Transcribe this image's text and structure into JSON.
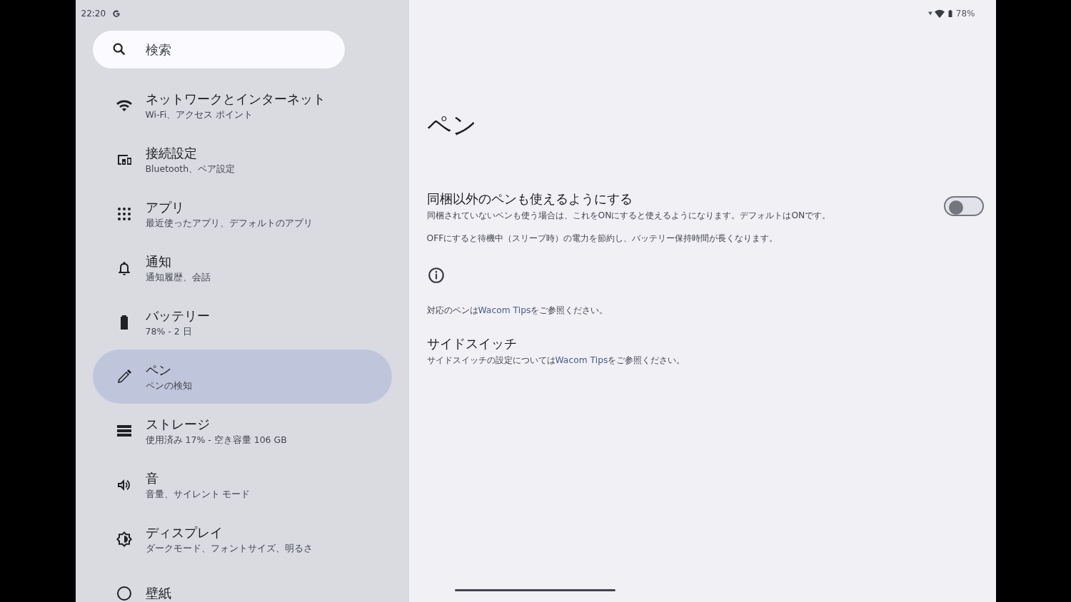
{
  "status_bar": {
    "time": "22:20",
    "battery": "78%"
  },
  "search": {
    "placeholder": "検索"
  },
  "sidebar": {
    "items": [
      {
        "kind": "wifi",
        "title": "ネットワークとインターネット",
        "subtitle": "Wi-Fi、アクセス ポイント",
        "selected": false
      },
      {
        "kind": "devices",
        "title": "接続設定",
        "subtitle": "Bluetooth、ペア設定",
        "selected": false
      },
      {
        "kind": "apps",
        "title": "アプリ",
        "subtitle": "最近使ったアプリ、デフォルトのアプリ",
        "selected": false
      },
      {
        "kind": "bell",
        "title": "通知",
        "subtitle": "通知履歴、会話",
        "selected": false
      },
      {
        "kind": "battery",
        "title": "バッテリー",
        "subtitle": "78% - 2 日",
        "selected": false
      },
      {
        "kind": "pen",
        "title": "ペン",
        "subtitle": "ペンの検知",
        "selected": true
      },
      {
        "kind": "storage",
        "title": "ストレージ",
        "subtitle": "使用済み 17% - 空き容量 106 GB",
        "selected": false
      },
      {
        "kind": "sound",
        "title": "音",
        "subtitle": "音量、サイレント モード",
        "selected": false
      },
      {
        "kind": "display",
        "title": "ディスプレイ",
        "subtitle": "ダークモード、フォントサイズ、明るさ",
        "selected": false
      },
      {
        "kind": "wallpaper",
        "title": "壁紙",
        "selected": false
      }
    ]
  },
  "page": {
    "title": "ペン",
    "toggle_setting": {
      "title": "同梱以外のペンも使えるようにする",
      "summary": "同梱されていないペンも使う場合は、これをONにすると使えるようになります。デフォルトはONです。",
      "on": false
    },
    "note": "OFFにすると待機中（スリープ時）の電力を節約し、バッテリー保持時間が長くなります。",
    "info": {
      "before": "対応のペンは",
      "link": "Wacom Tips",
      "after": "をご参照ください。"
    },
    "side_switch": {
      "title": "サイドスイッチ",
      "before": "サイドスイッチの設定については",
      "link": "Wacom Tips",
      "after": "をご参照ください。"
    }
  }
}
